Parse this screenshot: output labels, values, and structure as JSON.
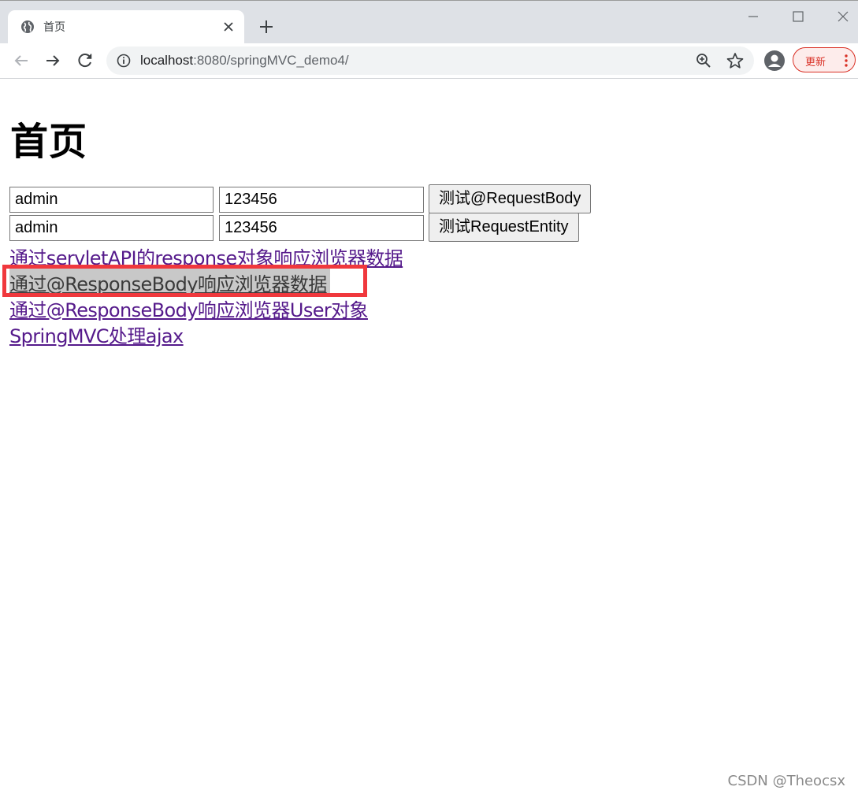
{
  "browser": {
    "tab_title": "首页",
    "url_host": "localhost",
    "url_rest": ":8080/springMVC_demo4/",
    "update_label": "更新"
  },
  "page": {
    "heading": "首页",
    "forms": [
      {
        "username": "admin",
        "password": "123456",
        "button": "测试@RequestBody"
      },
      {
        "username": "admin",
        "password": "123456",
        "button": "测试RequestEntity"
      }
    ],
    "links": [
      "通过servletAPI的response对象响应浏览器数据",
      "通过@ResponseBody响应浏览器数据",
      "通过@ResponseBody响应浏览器User对象",
      "SpringMVC处理ajax"
    ],
    "highlighted_link_index": 1
  },
  "watermark": "CSDN @Theocsx",
  "colors": {
    "link_visited": "#551a8b",
    "highlight_border": "#f0383d",
    "update_red": "#d93025"
  }
}
